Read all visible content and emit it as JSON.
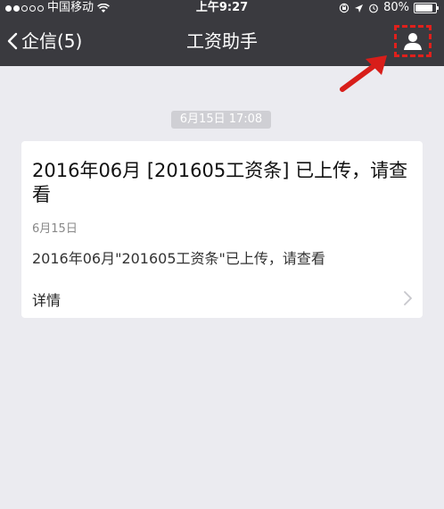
{
  "status_bar": {
    "carrier": "中国移动",
    "time": "上午9:27",
    "battery": "80%"
  },
  "nav": {
    "back_label": "企信(5)",
    "title": "工资助手"
  },
  "timestamp": "6月15日 17:08",
  "card": {
    "headline": "2016年06月 [201605工资条] 已上传，请查看",
    "date": "6月15日",
    "summary": "2016年06月\"201605工资条\"已上传，请查看",
    "details_label": "详情"
  },
  "colors": {
    "header_bg": "#3a3a3f",
    "page_bg": "#ebebf0",
    "highlight_red": "#e0201c"
  }
}
